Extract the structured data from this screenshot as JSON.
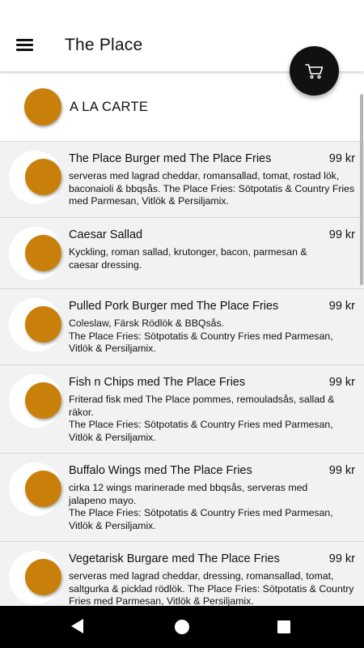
{
  "app": {
    "title": "The Place"
  },
  "toolbar": {
    "menu_icon": "hamburger-menu-icon",
    "cart_icon": "shopping-cart-icon"
  },
  "category": {
    "title": "A LA CARTE"
  },
  "items": [
    {
      "name": "The Place Burger med The Place Fries",
      "price": "99 kr",
      "desc": "serveras med lagrad cheddar, romansallad, tomat,  rostad lök, baconaioli & bbqsås. The Place Fries: Sötpotatis & Country Fries med Parmesan, Vitlök & Persiljamix."
    },
    {
      "name": "Caesar Sallad",
      "price": "99 kr",
      "desc": "Kyckling, roman sallad, krutonger, bacon, parmesan & caesar dressing."
    },
    {
      "name": "Pulled Pork Burger med The Place Fries",
      "price": "99 kr",
      "desc": "Coleslaw, Färsk Rödlök & BBQsås.\nThe Place Fries: Sötpotatis & Country Fries med Parmesan, Vitlök & Persiljamix."
    },
    {
      "name": "Fish n Chips med The Place Fries",
      "price": "99 kr",
      "desc": "Friterad fisk med The Place pommes, remouladsås, sallad & räkor.\nThe Place Fries: Sötpotatis & Country Fries med Parmesan, Vitlök & Persiljamix."
    },
    {
      "name": "Buffalo Wings med The Place Fries",
      "price": "99 kr",
      "desc": "cirka 12 wings marinerade med bbqsås, serveras med jalapeno mayo.\nThe Place Fries: Sötpotatis & Country Fries med Parmesan, Vitlök & Persiljamix."
    },
    {
      "name": "Vegetarisk Burgare med The Place Fries",
      "price": "99 kr",
      "desc": "serveras med lagrad cheddar, dressing, romansallad, tomat, saltgurka & picklad rödlök. The Place Fries: Sötpotatis & Country Fries med Parmesan, Vitlök & Persiljamix."
    }
  ],
  "colors": {
    "accent": "#c8800a",
    "fab": "#111111",
    "appbar": "#ffffff",
    "background": "#f2f2f2",
    "navbar": "#000000"
  },
  "navigation": {
    "back_icon": "back-triangle-icon",
    "home_icon": "home-circle-icon",
    "recent_icon": "recent-apps-square-icon"
  }
}
